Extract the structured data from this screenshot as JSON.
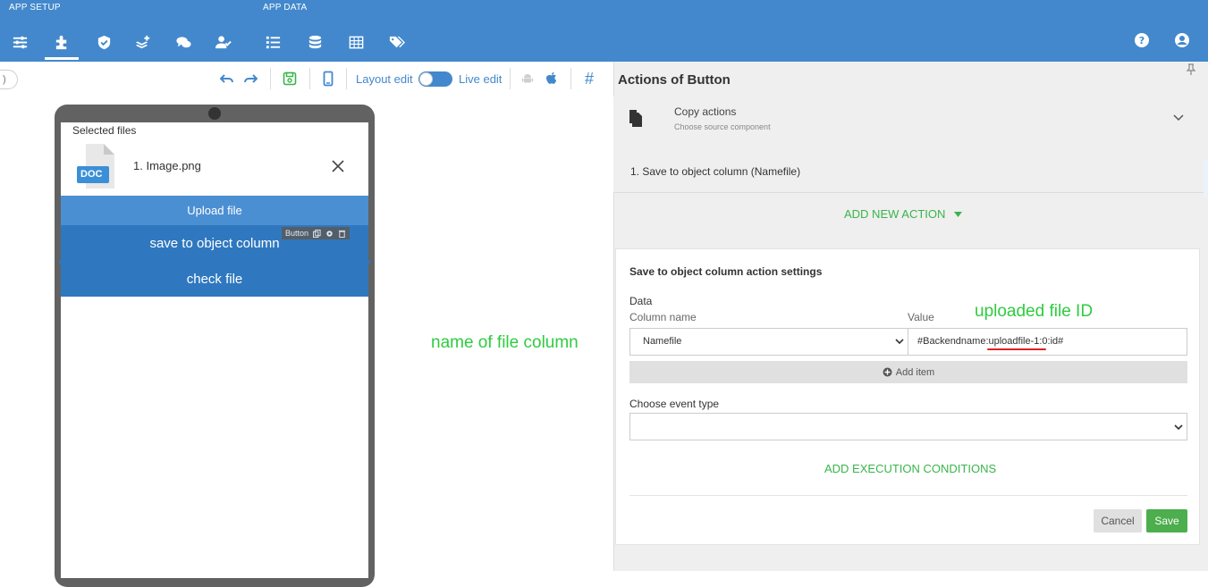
{
  "topbar": {
    "section_app_setup": "APP SETUP",
    "section_app_data": "APP DATA",
    "nav_icons": [
      "sliders-icon",
      "puzzle-icon",
      "shield-icon",
      "layers-plus-icon",
      "chat-icon",
      "user-check-icon",
      "list-icon",
      "database-icon",
      "table-icon",
      "tags-icon"
    ],
    "right_icons": [
      "help-circle-icon",
      "user-circle-icon"
    ],
    "color": "#4388cc"
  },
  "toolbar": {
    "layout_edit_label": "Layout edit",
    "live_edit_label": "Live edit",
    "hash_label": "#",
    "zoom_text": ")"
  },
  "phone": {
    "selected_files_label": "Selected files",
    "file_icon_label": "DOC",
    "file_name": "1. Image.png",
    "upload_button": "Upload file",
    "save_button": "save to object column",
    "check_button": "check file",
    "tools_label": "Button"
  },
  "annotations": {
    "name_of_file_column": "name of file column",
    "uploaded_file_id": "uploaded file ID"
  },
  "panel": {
    "title": "Actions of Button",
    "copy_actions_title": "Copy actions",
    "copy_actions_sub": "Choose source component",
    "action_item": "1.   Save to object column (Namefile)",
    "add_new_action": "ADD NEW ACTION",
    "settings_title": "Save to object column action settings",
    "data_label": "Data",
    "column_name_label": "Column name",
    "value_label": "Value",
    "column_value": "Namefile",
    "value_text": "#Backendname:uploadfile-1:0:id#",
    "add_item": "Add item",
    "event_type_label": "Choose event type",
    "event_type_value": "",
    "exec_conditions": "ADD EXECUTION CONDITIONS",
    "cancel": "Cancel",
    "save": "Save"
  },
  "colors": {
    "accent_blue": "#4388cc",
    "button_blue": "#2f78bf",
    "green": "#39b54a",
    "annotation_green": "#2ecc40",
    "underline_red": "#e02020"
  }
}
